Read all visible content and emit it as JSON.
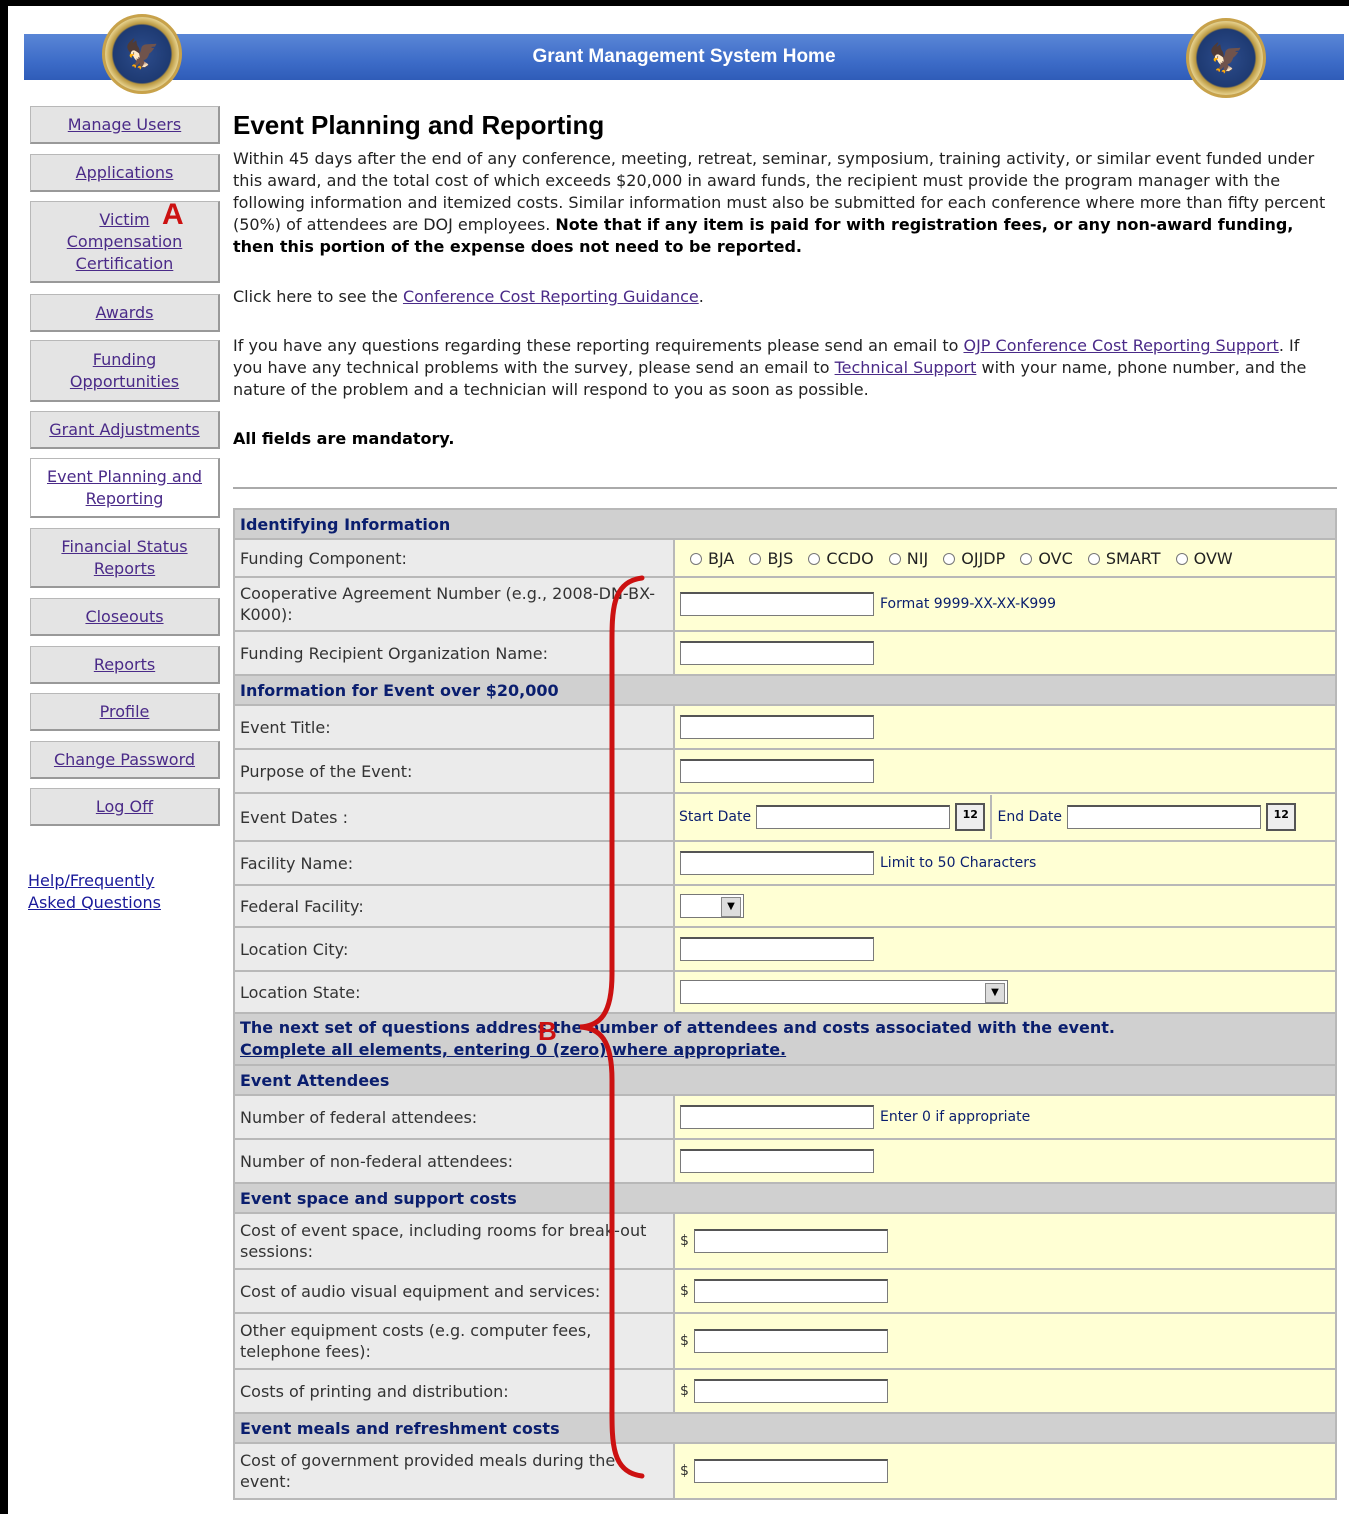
{
  "banner": {
    "title": "Grant Management System Home"
  },
  "sidebar": {
    "items": [
      {
        "label": "Manage Users"
      },
      {
        "label": "Applications"
      },
      {
        "label": "Victim Compensation Certification"
      },
      {
        "label": "Awards"
      },
      {
        "label": "Funding Opportunities"
      },
      {
        "label": "Grant Adjustments"
      },
      {
        "label": "Event Planning and Reporting"
      },
      {
        "label": "Financial Status Reports"
      },
      {
        "label": "Closeouts"
      },
      {
        "label": "Reports"
      },
      {
        "label": "Profile"
      },
      {
        "label": "Change Password"
      },
      {
        "label": "Log Off"
      }
    ],
    "help": "Help/Frequently Asked Questions"
  },
  "markers": {
    "a": "A",
    "b": "B"
  },
  "main": {
    "title": "Event Planning and Reporting",
    "intro": "Within 45 days after the end of any conference, meeting, retreat, seminar, symposium, training activity, or similar event funded under this award, and the total cost of which exceeds $20,000 in award funds, the recipient must provide the program manager with the following information and itemized costs. Similar information must also be submitted for each conference where more than fifty percent (50%) of attendees are DOJ employees. ",
    "intro_bold": "Note that if any item is paid for with registration fees, or any non-award funding, then this portion of the expense does not need to be reported.",
    "guidance_prefix": "Click here to see the ",
    "guidance_link": "Conference Cost Reporting Guidance",
    "guidance_suffix": ".",
    "contact_1": "If you have any questions regarding these reporting requirements please send an email to ",
    "contact_link1": "OJP Conference Cost Reporting Support",
    "contact_2": ". If you have any technical problems with the survey, please send an email to ",
    "contact_link2": "Technical Support",
    "contact_3": " with your name, phone number, and the nature of the problem and a technician will respond to you as soon as possible.",
    "mandatory": "All fields are mandatory."
  },
  "form": {
    "sec_identifying": "Identifying Information",
    "funding_component": "Funding Component:",
    "components": [
      "BJA",
      "BJS",
      "CCDO",
      "NIJ",
      "OJJDP",
      "OVC",
      "SMART",
      "OVW"
    ],
    "coop_number": "Cooperative Agreement Number (e.g., 2008-DN-BX-K000):",
    "coop_hint": "Format 9999-XX-XX-K999",
    "recipient_org": "Funding Recipient Organization Name:",
    "sec_event": "Information for Event over $20,000",
    "event_title": "Event Title:",
    "purpose": "Purpose of the Event:",
    "event_dates": "Event Dates :",
    "start_date": "Start Date",
    "end_date": "End Date",
    "facility_name": "Facility Name:",
    "facility_hint": "Limit to 50 Characters",
    "federal_facility": "Federal Facility:",
    "location_city": "Location City:",
    "location_state": "Location State:",
    "next_questions": "The next set of questions address the number of attendees and costs associated with the event.",
    "complete_all": "Complete all elements, entering 0 (zero) where appropriate.",
    "sec_attendees": "Event Attendees",
    "federal_attendees": "Number of federal attendees:",
    "attendees_hint": "Enter 0 if appropriate",
    "nonfederal_attendees": "Number of non-federal attendees:",
    "sec_space": "Event space and support costs",
    "cost_space": "Cost of event space, including rooms for break-out sessions:",
    "cost_av": "Cost of audio visual equipment and services:",
    "cost_other_equipment": "Other equipment costs (e.g. computer fees, telephone fees):",
    "cost_printing": "Costs of printing and distribution:",
    "sec_meals": "Event meals and refreshment costs",
    "cost_meals": "Cost of government provided meals during the event:",
    "currency": "$",
    "calendar_icon_text": "12"
  },
  "colors": {
    "banner": "#3d6cc8",
    "label_bg": "#ebebeb",
    "field_bg": "#ffffd4",
    "section_bg": "#d0d0d0",
    "marker": "#cc1111"
  }
}
